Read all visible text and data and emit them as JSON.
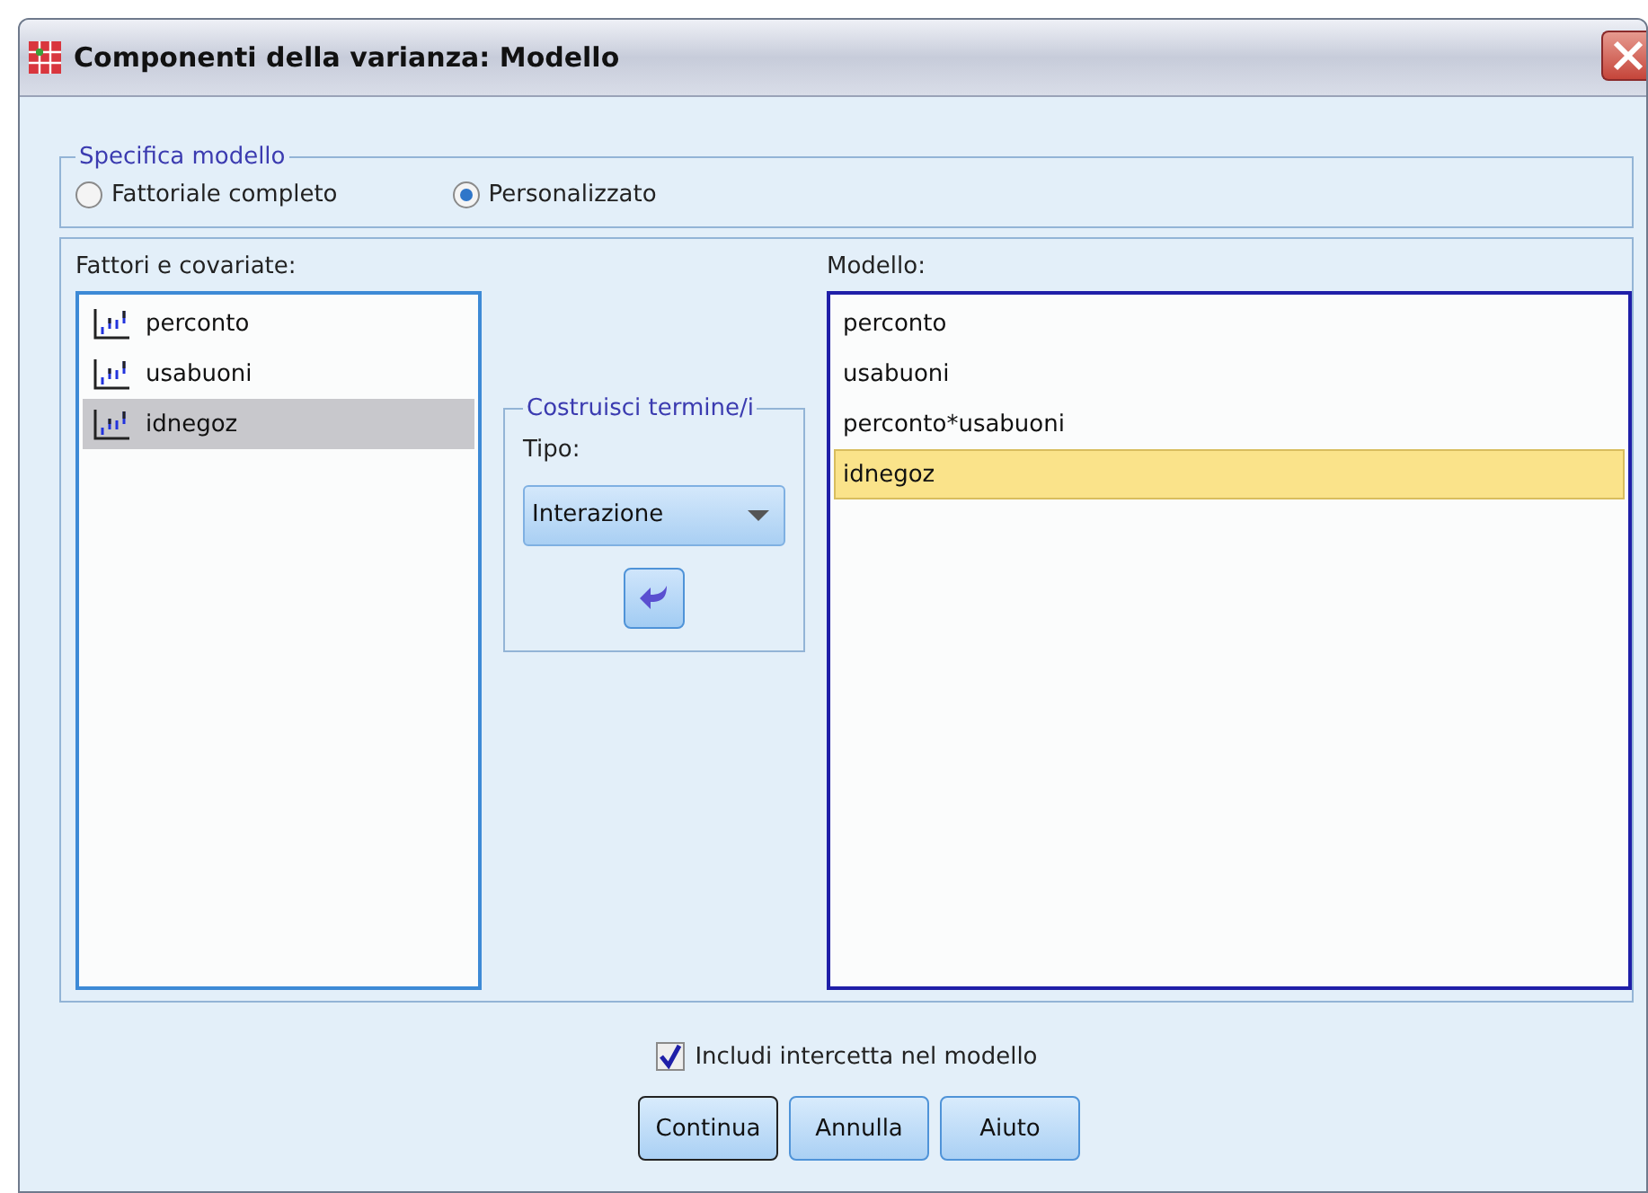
{
  "window": {
    "title": "Componenti della varianza: Modello"
  },
  "model_spec": {
    "title": "Specifica modello",
    "options": [
      {
        "label": "Fattoriale completo",
        "selected": false
      },
      {
        "label": "Personalizzato",
        "selected": true
      }
    ]
  },
  "factors": {
    "label": "Fattori e covariate:",
    "items": [
      {
        "name": "perconto",
        "selected": false
      },
      {
        "name": "usabuoni",
        "selected": false
      },
      {
        "name": "idnegoz",
        "selected": true
      }
    ]
  },
  "build_terms": {
    "title": "Costruisci termine/i",
    "type_label": "Tipo:",
    "type_value": "Interazione"
  },
  "model": {
    "label": "Modello:",
    "items": [
      {
        "name": "perconto",
        "selected": false
      },
      {
        "name": "usabuoni",
        "selected": false
      },
      {
        "name": "perconto*usabuoni",
        "selected": false
      },
      {
        "name": "idnegoz",
        "selected": true
      }
    ]
  },
  "include_intercept": {
    "label": "Includi intercetta nel modello",
    "checked": true
  },
  "buttons": [
    {
      "label": "Continua",
      "default": true
    },
    {
      "label": "Annulla",
      "default": false
    },
    {
      "label": "Aiuto",
      "default": false
    }
  ]
}
